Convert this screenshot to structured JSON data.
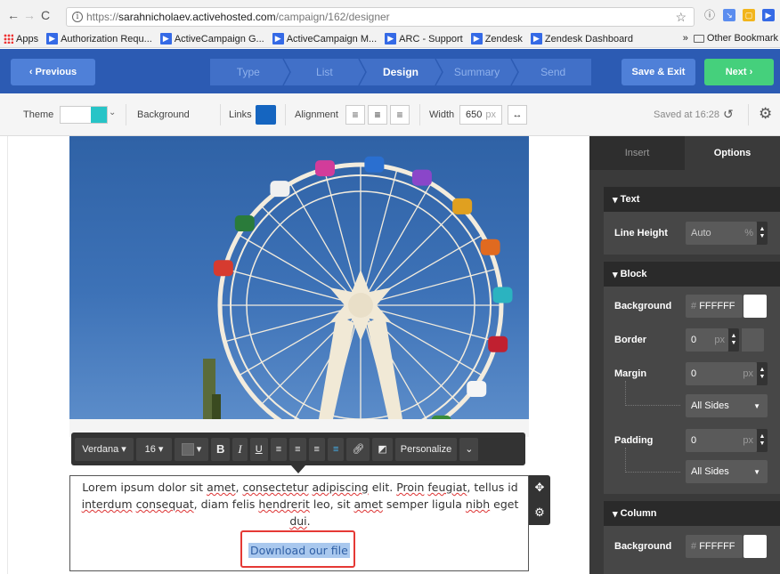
{
  "browser": {
    "url_scheme": "https://",
    "url_host": "sarahnicholaev.activehosted.com",
    "url_path": "/campaign/162/designer",
    "bookmarks": [
      {
        "label": "Apps"
      },
      {
        "label": "Authorization Requ..."
      },
      {
        "label": "ActiveCampaign G..."
      },
      {
        "label": "ActiveCampaign M..."
      },
      {
        "label": "ARC - Support"
      },
      {
        "label": "Zendesk"
      },
      {
        "label": "Zendesk Dashboard"
      }
    ],
    "more_bookmarks": "»",
    "other_bookmarks": "Other Bookmark"
  },
  "nav": {
    "previous": "‹  Previous",
    "steps": [
      "Type",
      "List",
      "Design",
      "Summary",
      "Send"
    ],
    "active_step": "Design",
    "save_exit": "Save & Exit",
    "next": "Next   ›"
  },
  "toolbar": {
    "theme_label": "Theme",
    "background_label": "Background",
    "links_label": "Links",
    "alignment_label": "Alignment",
    "width_label": "Width",
    "width_value": "650",
    "width_unit": "px",
    "saved_text": "Saved at 16:28",
    "theme_color": "#27c4c7",
    "links_color": "#1565c0"
  },
  "editor": {
    "font": "Verdana",
    "size": "16",
    "personalize": "Personalize",
    "paragraph": {
      "w1": "Lorem ipsum dolor sit ",
      "amet1": "amet",
      "w2": ", ",
      "consectetur": "consectetur",
      "w3": " ",
      "adipiscing": "adipiscing",
      "w4": " elit. ",
      "proin": "Proin",
      "w5": " ",
      "feugiat": "feugiat",
      "w6": ", tellus id ",
      "interdum": "interdum",
      "w7": " ",
      "consequat": "consequat",
      "w8": ", diam felis ",
      "hendrerit": "hendrerit",
      "w9": " leo, sit ",
      "amet2": "amet",
      "w10": " semper ligula ",
      "nibh": "nibh",
      "w11": " eget ",
      "dui": "dui",
      "w12": "."
    },
    "download_link": "Download our file"
  },
  "panel": {
    "tabs": [
      "Insert",
      "Options"
    ],
    "active_tab": "Options",
    "text_section": "Text",
    "line_height_label": "Line Height",
    "line_height_value": "Auto",
    "line_height_unit": "%",
    "block_section": "Block",
    "background_label": "Background",
    "background_value": "FFFFFF",
    "hash": "#",
    "border_label": "Border",
    "border_value": "0",
    "border_unit": "px",
    "margin_label": "Margin",
    "margin_value": "0",
    "margin_unit": "px",
    "margin_sides": "All Sides",
    "padding_label": "Padding",
    "padding_value": "0",
    "padding_unit": "px",
    "padding_sides": "All Sides",
    "column_section": "Column",
    "column_bg_label": "Background",
    "column_bg_value": "FFFFFF"
  }
}
